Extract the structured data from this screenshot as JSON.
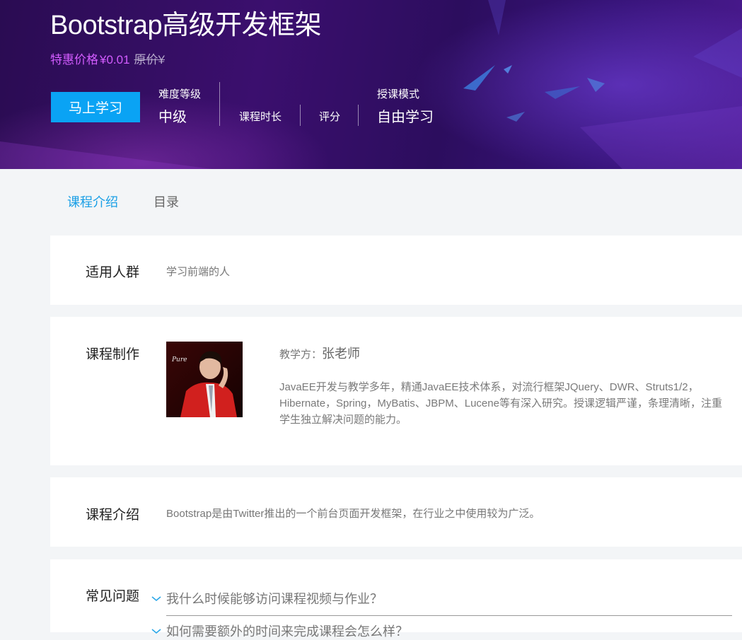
{
  "course": {
    "title": "Bootstrap高级开发框架",
    "price_label": "特惠价格",
    "price_value": "¥0.01",
    "original_price": "原价¥",
    "study_button": "马上学习",
    "stats": {
      "difficulty_label": "难度等级",
      "difficulty_value": "中级",
      "duration_label": "课程时长",
      "rating_label": "评分",
      "mode_label": "授课模式",
      "mode_value": "自由学习"
    }
  },
  "tabs": [
    {
      "label": "课程介绍",
      "active": true
    },
    {
      "label": "目录",
      "active": false
    }
  ],
  "audience": {
    "title": "适用人群",
    "text": "学习前端的人"
  },
  "production": {
    "title": "课程制作",
    "teacher_label": "教学方：",
    "teacher_name": "张老师",
    "photo_caption": "Pure",
    "bio": "JavaEE开发与教学多年，精通JavaEE技术体系，对流行框架JQuery、DWR、Struts1/2，Hibernate，Spring，MyBatis、JBPM、Lucene等有深入研究。授课逻辑严谨，条理清晰，注重学生独立解决问题的能力。"
  },
  "intro": {
    "title": "课程介绍",
    "text": "Bootstrap是由Twitter推出的一个前台页面开发框架，在行业之中使用较为广泛。"
  },
  "faq": {
    "title": "常见问题",
    "items": [
      "我什么时候能够访问课程视频与作业？",
      "如何需要额外的时间来完成课程会怎么样？"
    ]
  },
  "colors": {
    "accent": "#1a9fe6",
    "button": "#0aa3f4",
    "price": "#d35cff",
    "banner_dark": "#2a0c52"
  }
}
